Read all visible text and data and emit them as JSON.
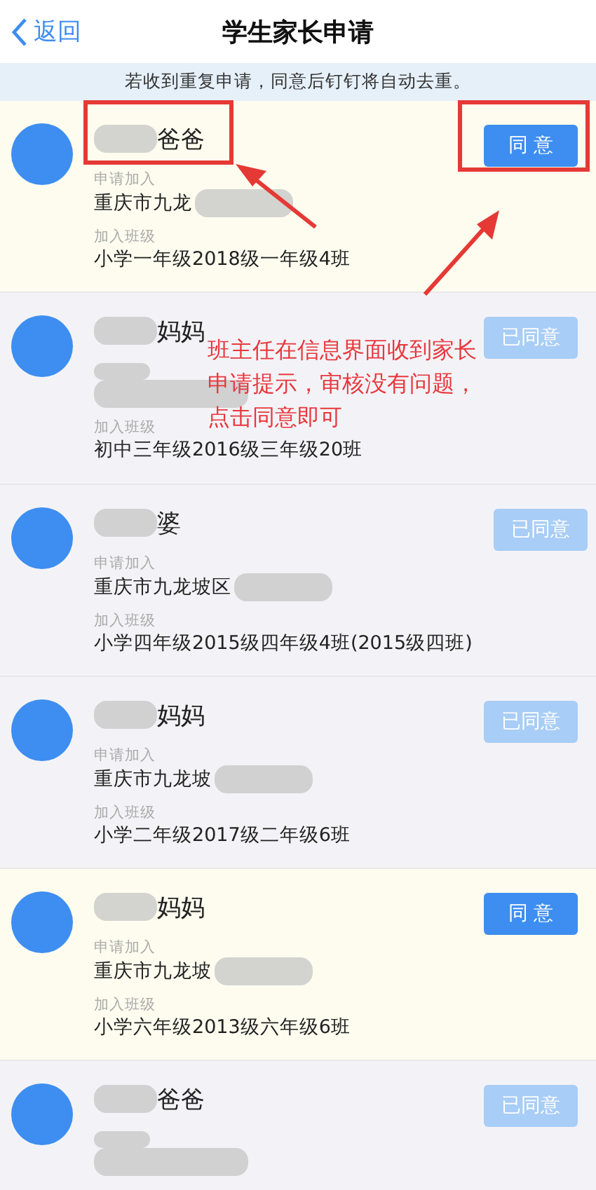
{
  "nav": {
    "back": "返回",
    "title": "学生家长申请"
  },
  "notice": "若收到重复申请，同意后钉钉将自动去重。",
  "requests": [
    {
      "name": "爸爸",
      "pending": true,
      "button": "同 意",
      "fields": [
        {
          "label": "申请加入",
          "value": "重庆市九龙"
        },
        {
          "label": "加入班级",
          "value": "小学一年级2018级一年级4班"
        }
      ]
    },
    {
      "name": "妈妈",
      "pending": false,
      "button": "已同意",
      "fields": [
        {
          "kind": "class",
          "label": "加入班级",
          "value": "初中三年级2016级三年级20班"
        }
      ]
    },
    {
      "name": "婆",
      "pending": false,
      "button": "已同意",
      "fields": [
        {
          "label": "申请加入",
          "value": "重庆市九龙坡区"
        },
        {
          "label": "加入班级",
          "value": "小学四年级2015级四年级4班(2015级四班)"
        }
      ]
    },
    {
      "name": "妈妈",
      "pending": false,
      "button": "已同意",
      "fields": [
        {
          "label": "申请加入",
          "value": "重庆市九龙坡"
        },
        {
          "label": "加入班级",
          "value": "小学二年级2017级二年级6班"
        }
      ]
    },
    {
      "name": "妈妈",
      "pending": true,
      "button": "同 意",
      "fields": [
        {
          "label": "申请加入",
          "value": "重庆市九龙坡"
        },
        {
          "label": "加入班级",
          "value": "小学六年级2013级六年级6班"
        }
      ]
    },
    {
      "name": "爸爸",
      "pending": false,
      "button": "已同意"
    }
  ],
  "annotation": {
    "text": "班主任在信息界面收到家长申请提示，审核没有问题，点击同意即可"
  }
}
